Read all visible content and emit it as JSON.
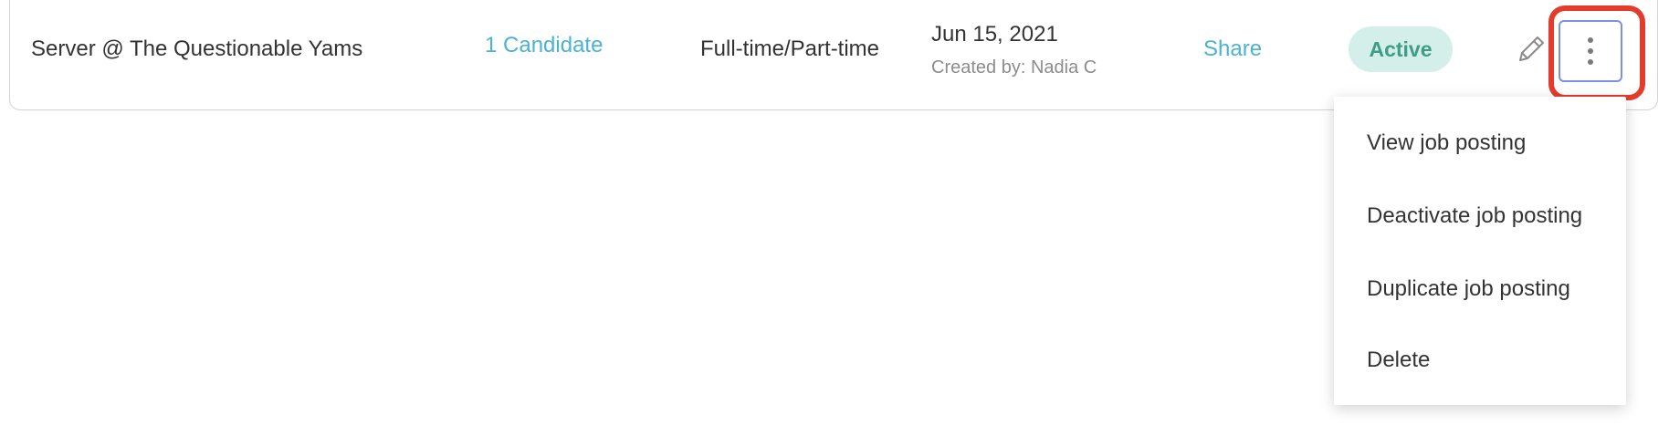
{
  "job_row": {
    "title": "Server @ The Questionable Yams",
    "candidates_link": "1 Candidate",
    "job_type": "Full-time/Part-time",
    "date": "Jun 15, 2021",
    "created_by": "Created by: Nadia C",
    "share_link": "Share",
    "status": "Active",
    "edit_icon": "pencil-icon",
    "more_icon": "vertical-ellipsis-icon"
  },
  "colors": {
    "link": "#4bb3d1",
    "status_bg": "#d4efea",
    "status_text": "#3f9c86",
    "highlight": "#e43c2c",
    "focus_border": "#7e8fe6"
  },
  "dropdown_menu": {
    "items": [
      {
        "label": "View job posting"
      },
      {
        "label": "Deactivate job posting"
      },
      {
        "label": "Duplicate job posting"
      },
      {
        "label": "Delete"
      }
    ]
  }
}
